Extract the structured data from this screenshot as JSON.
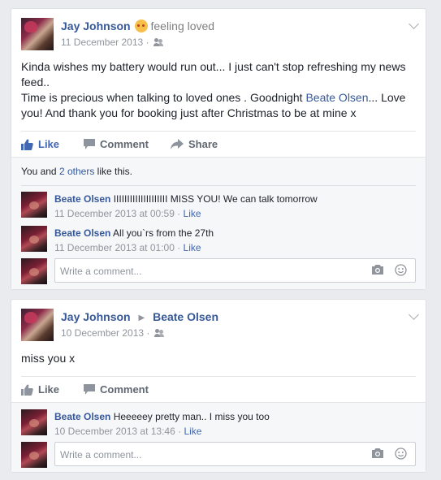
{
  "posts": [
    {
      "author": "Jay Johnson",
      "feeling": "feeling loved",
      "date": "11 December 2013 ·",
      "text_line1": "Kinda wishes my battery would run out... I just can't stop refreshing my news feed..",
      "text_line2a": "Time is precious when talking to loved ones . Goodnight ",
      "text_tag": "Beate Olsen",
      "text_line2b": "... Love you! And thank you for booking just after Christmas to be at mine x",
      "actions": {
        "like": "Like",
        "comment": "Comment",
        "share": "Share"
      },
      "likes": {
        "prefix": "You and ",
        "link": "2 others",
        "suffix": " like this."
      },
      "comments": [
        {
          "author": "Beate Olsen",
          "text": "IIIIIIIIIIIIIIIIIIII MISS YOU! We can talk tomorrow",
          "time": "11 December 2013 at 00:59 · ",
          "like": "Like"
        },
        {
          "author": "Beate Olsen",
          "text": "All you`rs from the 27th",
          "time": "11 December 2013 at 01:00 · ",
          "like": "Like"
        }
      ],
      "write_placeholder": "Write a comment..."
    },
    {
      "author": "Jay Johnson",
      "target": "Beate Olsen",
      "date": "10 December 2013 ·",
      "text": "miss you x",
      "actions": {
        "like": "Like",
        "comment": "Comment"
      },
      "comments": [
        {
          "author": "Beate Olsen",
          "text": "Heeeeey pretty man.. I miss you too",
          "time": "10 December 2013 at 13:46 · ",
          "like": "Like"
        }
      ],
      "write_placeholder": "Write a comment..."
    }
  ],
  "icons": [
    "friends-icon",
    "thumbs-up-icon",
    "comment-icon",
    "share-icon",
    "camera-icon",
    "smiley-icon",
    "chevron-down-icon",
    "feeling-emoji-icon"
  ],
  "colors": {
    "link": "#365899",
    "like_active": "#4267b2",
    "muted": "#90949c",
    "bg": "#e9ebee"
  }
}
